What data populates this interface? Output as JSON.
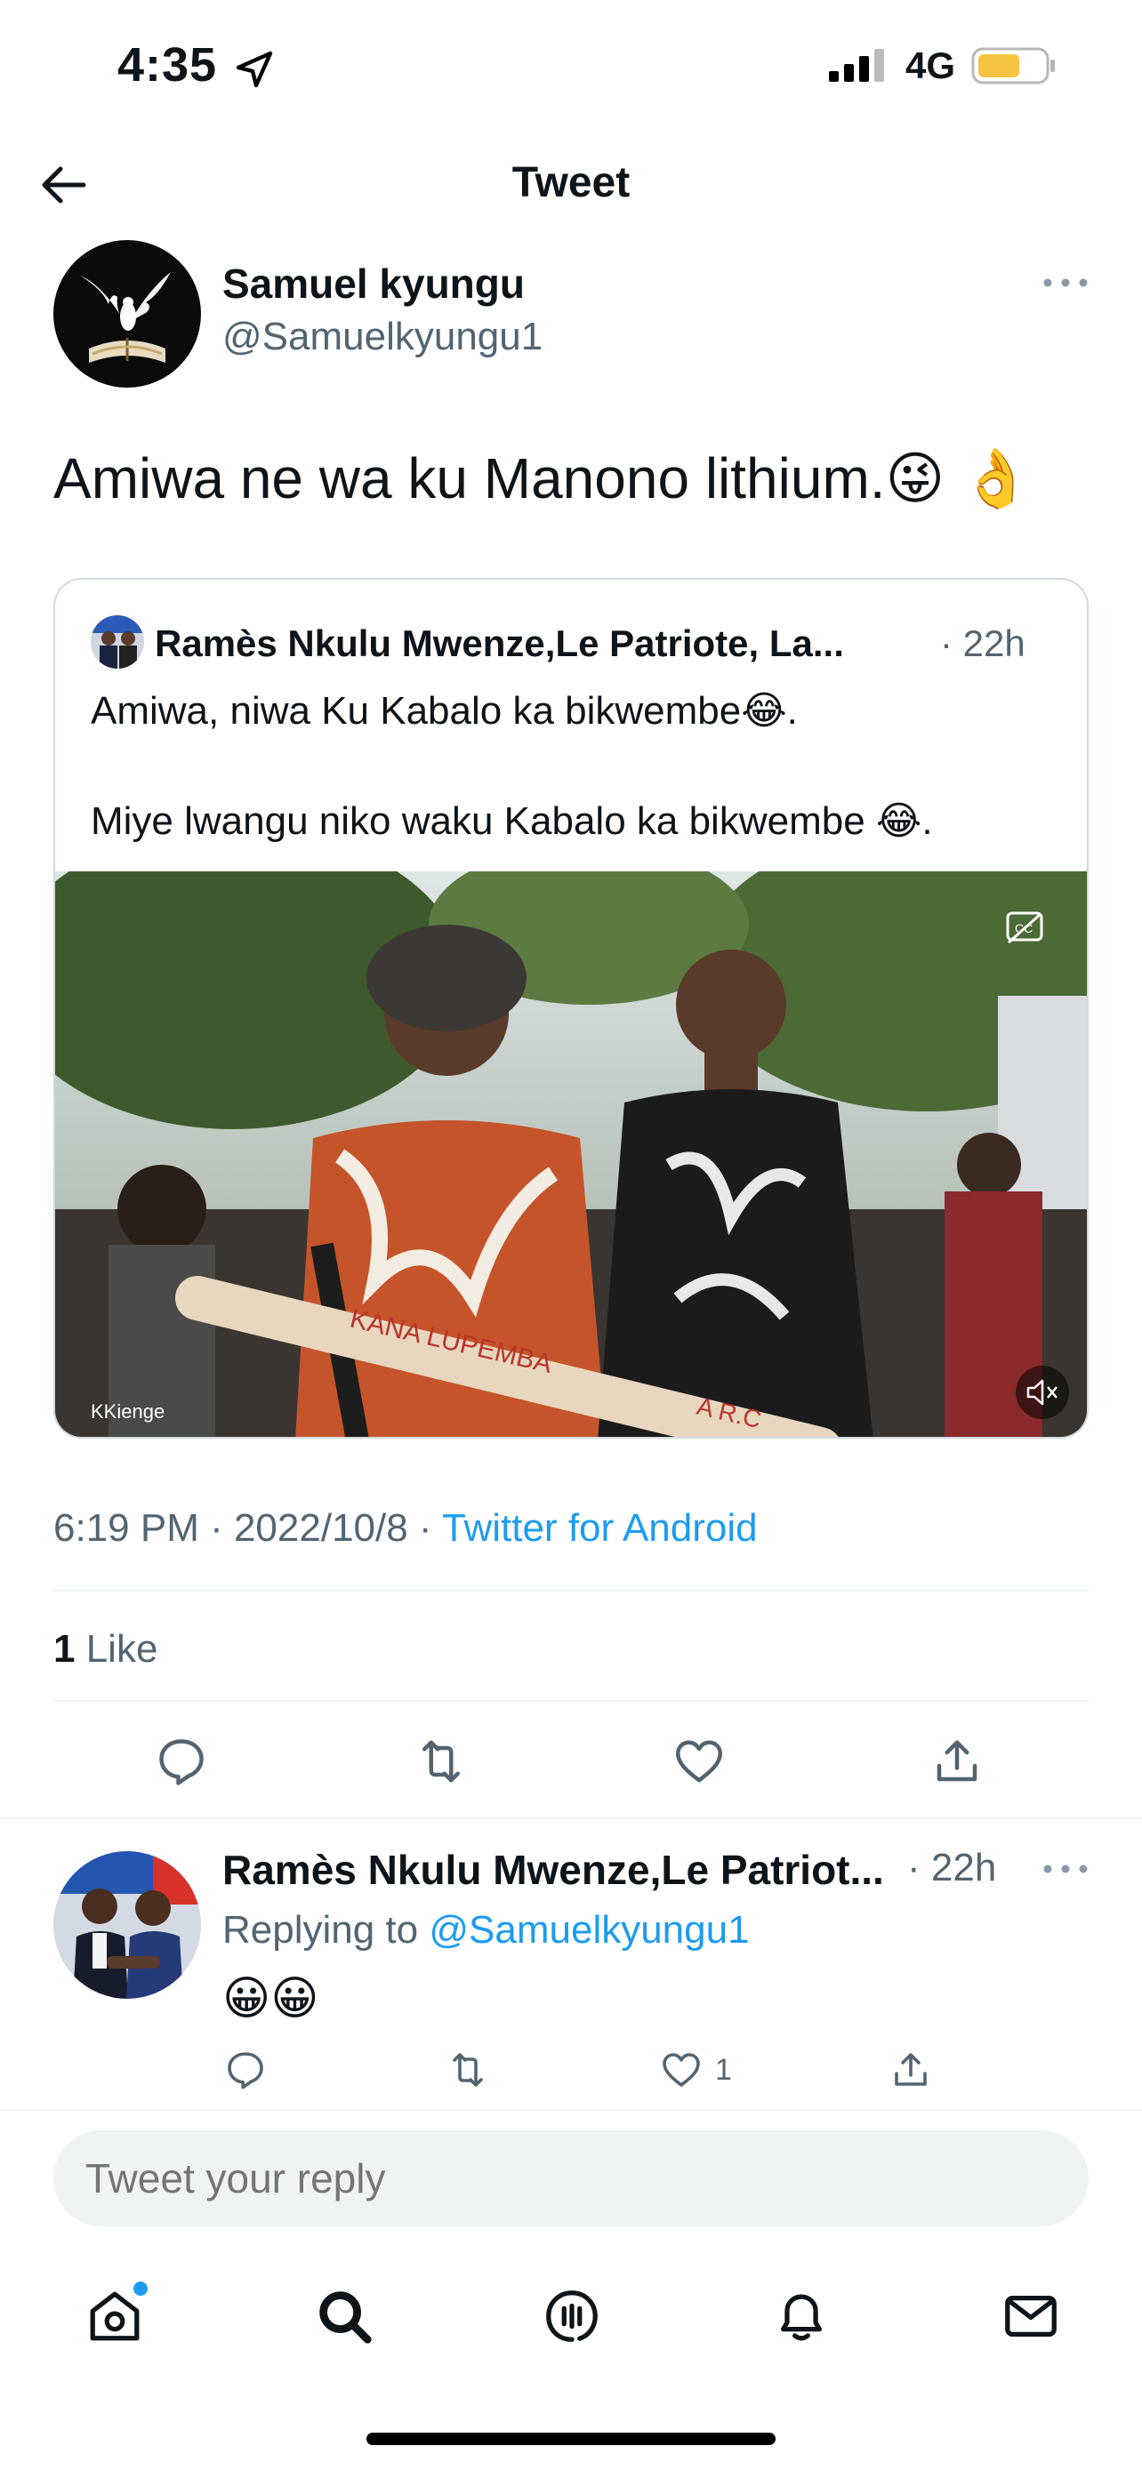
{
  "status_bar": {
    "time": "4:35",
    "network": "4G"
  },
  "header": {
    "title": "Tweet"
  },
  "tweet": {
    "author_name": "Samuel kyungu",
    "author_handle": "@Samuelkyungu1",
    "text": "Amiwa ne wa ku Manono lithium.😜 👌",
    "timestamp": "6:19 PM · 2022/10/8 · ",
    "source": "Twitter for Android",
    "like_count": "1",
    "like_label": " Like"
  },
  "quoted": {
    "author_name": "Ramès Nkulu Mwenze,Le Patriote, La...",
    "time": "· 22h",
    "line1": "Amiwa, niwa Ku Kabalo ka bikwembe😂.",
    "line2": "Miye lwangu niko waku Kabalo ka bikwembe 😂.",
    "watermark": "KKienge",
    "sign1": "KANA LUPEMBA",
    "sign2": "A R.C"
  },
  "reply": {
    "author_name": "Ramès Nkulu Mwenze,Le Patriot...",
    "time": "· 22h",
    "replying_prefix": "Replying to ",
    "replying_handle": "@Samuelkyungu1",
    "text": "😀😀",
    "like_count": "1"
  },
  "composer": {
    "placeholder": "Tweet your reply"
  },
  "colors": {
    "accent": "#1d9bf0",
    "text": "#0f1419",
    "secondary": "#536471",
    "divider": "#eff3f4",
    "battery": "#f5c542"
  },
  "nav": [
    "home-icon",
    "search-icon",
    "spaces-icon",
    "notifications-icon",
    "messages-icon"
  ]
}
